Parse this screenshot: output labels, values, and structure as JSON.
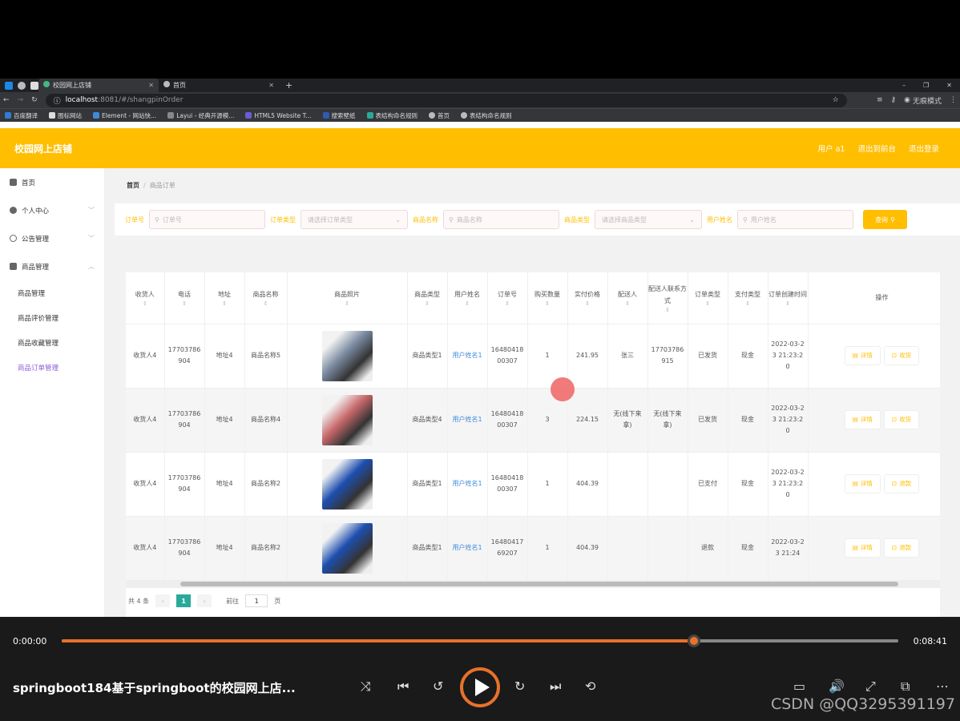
{
  "browser": {
    "tabs": [
      {
        "title": "校园网上店铺",
        "active": true
      },
      {
        "title": "首页",
        "active": false
      }
    ],
    "url_host": "localhost",
    "url_path": ":8081/#/shangpinOrder",
    "incognito_label": "无痕模式",
    "bookmarks": [
      "百度翻译",
      "图标网站",
      "Element - 网站快...",
      "Layui - 经典开源模...",
      "HTML5 Website T...",
      "搜索壁纸",
      "表结构命名规则",
      "首页",
      "表结构命名规则"
    ]
  },
  "header": {
    "title": "校园网上店铺",
    "user": "用户 a1",
    "front": "退出到前台",
    "logout": "退出登录"
  },
  "sidebar": {
    "items": [
      {
        "label": "首页",
        "icon": "home-icon"
      },
      {
        "label": "个人中心",
        "icon": "user-icon",
        "chevron": "﹀"
      },
      {
        "label": "公告管理",
        "icon": "notice-icon",
        "chevron": "﹀"
      },
      {
        "label": "商品管理",
        "icon": "goods-icon",
        "chevron": "︿"
      }
    ],
    "subitems": [
      "商品管理",
      "商品评价管理",
      "商品收藏管理",
      "商品订单管理"
    ]
  },
  "breadcrumb": {
    "home": "首页",
    "sep": "/",
    "current": "商品订单"
  },
  "search": {
    "order_no_label": "订单号",
    "order_no_placeholder": "订单号",
    "order_type_label": "订单类型",
    "order_type_placeholder": "请选择订单类型",
    "goods_name_label": "商品名称",
    "goods_name_placeholder": "商品名称",
    "goods_type_label": "商品类型",
    "goods_type_placeholder": "请选择商品类型",
    "user_name_label": "用户姓名",
    "user_name_placeholder": "用户姓名",
    "query_button": "查询"
  },
  "table": {
    "headers": [
      "收货人",
      "电话",
      "地址",
      "商品名称",
      "商品照片",
      "商品类型",
      "用户姓名",
      "订单号",
      "购买数量",
      "实付价格",
      "配送人",
      "配送人联系方式",
      "订单类型",
      "支付类型",
      "订单创建时间",
      "操作"
    ],
    "rows": [
      {
        "receiver": "收货人4",
        "phone": "17703786904",
        "address": "地址4",
        "goods_name": "商品名称5",
        "goods_type": "商品类型1",
        "user": "用户姓名1",
        "order_no": "1648041800307",
        "qty": "1",
        "price": "241.95",
        "courier": "张三",
        "courier_phone": "17703786915",
        "order_type": "已发货",
        "pay_type": "现金",
        "created": "2022-03-23 21:23:20",
        "btn1": "详情",
        "btn2": "收货",
        "photo": "#7a8aa0"
      },
      {
        "receiver": "收货人4",
        "phone": "17703786904",
        "address": "地址4",
        "goods_name": "商品名称4",
        "goods_type": "商品类型4",
        "user": "用户姓名1",
        "order_no": "1648041800307",
        "qty": "3",
        "price": "224.15",
        "courier": "无(线下来拿)",
        "courier_phone": "无(线下来拿)",
        "order_type": "已发货",
        "pay_type": "现金",
        "created": "2022-03-23 21:23:20",
        "btn1": "详情",
        "btn2": "收货",
        "photo": "#c8686a"
      },
      {
        "receiver": "收货人4",
        "phone": "17703786904",
        "address": "地址4",
        "goods_name": "商品名称2",
        "goods_type": "商品类型1",
        "user": "用户姓名1",
        "order_no": "1648041800307",
        "qty": "1",
        "price": "404.39",
        "courier": "",
        "courier_phone": "",
        "order_type": "已支付",
        "pay_type": "现金",
        "created": "2022-03-23 21:23:20",
        "btn1": "详情",
        "btn2": "退款",
        "photo": "#1e4fb0"
      },
      {
        "receiver": "收货人4",
        "phone": "17703786904",
        "address": "地址4",
        "goods_name": "商品名称2",
        "goods_type": "商品类型1",
        "user": "用户姓名1",
        "order_no": "1648041769207",
        "qty": "1",
        "price": "404.39",
        "courier": "",
        "courier_phone": "",
        "order_type": "退款",
        "pay_type": "现金",
        "created": "2022-03-23 21:24",
        "btn1": "详情",
        "btn2": "退款",
        "photo": "#1e4fb0"
      }
    ]
  },
  "pager": {
    "total": "共 4 条",
    "prev": "‹",
    "current": "1",
    "next": "›",
    "goto": "前往",
    "page_input": "1",
    "page_unit": "页"
  },
  "player": {
    "elapsed": "0:00:00",
    "duration": "0:08:41",
    "progress": 0.756,
    "title": "springboot184基于springboot的校园网上店...",
    "watermark": "CSDN @QQ3295391197"
  },
  "colors": {
    "accent": "#ffbe00",
    "player_accent": "#e8722a",
    "pager_active": "#2aa99a"
  }
}
